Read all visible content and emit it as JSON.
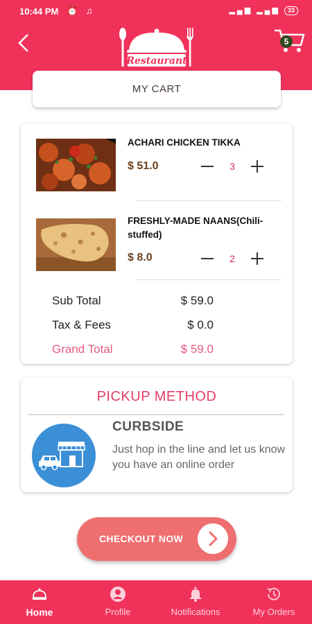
{
  "status_bar": {
    "time": "10:44 PM",
    "battery": "33"
  },
  "header": {
    "logo_text": "Restaurant",
    "cart_count": "5"
  },
  "tab": {
    "label": "MY CART"
  },
  "cart": {
    "items": [
      {
        "name": "ACHARI CHICKEN TIKKA",
        "price": "$ 51.0",
        "qty": "3"
      },
      {
        "name": "FRESHLY-MADE NAANS(Chili-stuffed)",
        "price": "$ 8.0",
        "qty": "2"
      }
    ],
    "summary": {
      "subtotal_label": "Sub Total",
      "subtotal_value": "$ 59.0",
      "tax_label": "Tax & Fees",
      "tax_value": "$ 0.0",
      "grand_label": "Grand Total",
      "grand_value": "$ 59.0"
    }
  },
  "pickup": {
    "title": "PICKUP METHOD",
    "method": "CURBSIDE",
    "description": "Just hop in the line and let us know you have an online order"
  },
  "checkout": {
    "label": "CHECKOUT NOW"
  },
  "nav": [
    {
      "label": "Home",
      "icon": "cloche-icon"
    },
    {
      "label": "Profile",
      "icon": "user-icon"
    },
    {
      "label": "Notifications",
      "icon": "bell-icon"
    },
    {
      "label": "My Orders",
      "icon": "history-icon"
    }
  ],
  "colors": {
    "brand": "#f0325b",
    "accent": "#e43d67",
    "checkout": "#ef6f70",
    "pickup_icon_bg": "#3b8fd6"
  }
}
